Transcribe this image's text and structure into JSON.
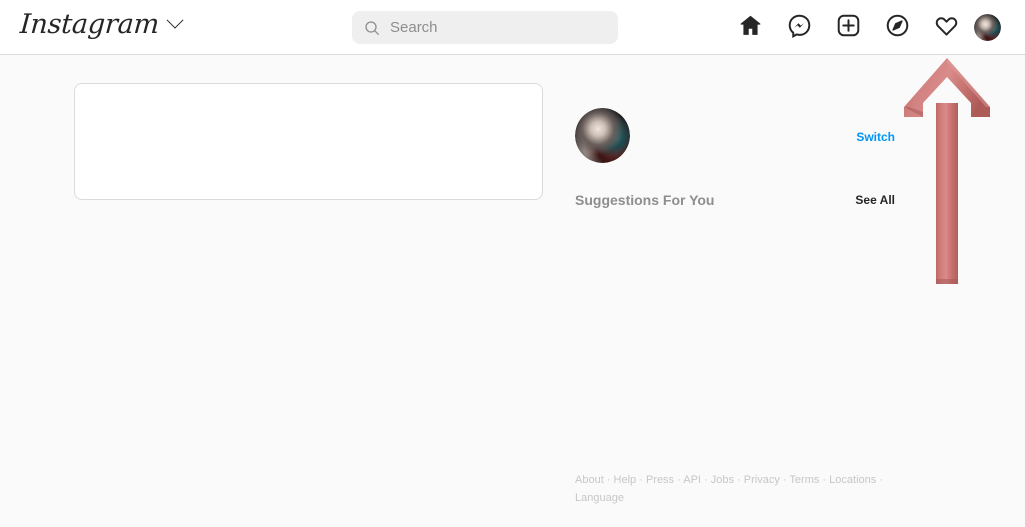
{
  "app": {
    "name": "Instagram",
    "brand_wordmark": "Instagram"
  },
  "header": {
    "brand_label": "Instagram",
    "brand_dropdown_icon": "chevron-down-icon",
    "search": {
      "placeholder": "Search",
      "value": "",
      "icon": "search-icon"
    },
    "nav": [
      {
        "name": "home",
        "icon": "home-icon",
        "label": "Home",
        "active": true
      },
      {
        "name": "messages",
        "icon": "messenger-icon",
        "label": "Messenger"
      },
      {
        "name": "new-post",
        "icon": "plus-square-icon",
        "label": "New post"
      },
      {
        "name": "explore",
        "icon": "compass-icon",
        "label": "Explore"
      },
      {
        "name": "activity",
        "icon": "heart-icon",
        "label": "Notifications"
      }
    ],
    "profile": {
      "name": "profile-avatar",
      "label": "Profile",
      "icon": "avatar"
    }
  },
  "main": {
    "feed_placeholder": {
      "name": "feed-card",
      "content": ""
    },
    "sidebar": {
      "account": {
        "avatar_label": "Account avatar",
        "switch_label": "Switch"
      },
      "suggestions": {
        "title": "Suggestions For You",
        "see_all_label": "See All"
      }
    }
  },
  "footer": {
    "links": [
      "About",
      "Help",
      "Press",
      "API",
      "Jobs",
      "Privacy",
      "Terms",
      "Locations",
      "Language"
    ],
    "separator": "·"
  },
  "annotation": {
    "type": "arrow",
    "direction": "up",
    "points_to": "profile-avatar",
    "color": "#c9706e",
    "highlight_color": "#d98886",
    "shadow_color": "#a85a58"
  },
  "colors": {
    "accent_blue": "#0095f6",
    "text_primary": "#262626",
    "text_secondary": "#8e8e8e",
    "border": "#dbdbdb",
    "page_background": "#fafafa",
    "surface": "#ffffff",
    "search_background": "#efefef"
  }
}
